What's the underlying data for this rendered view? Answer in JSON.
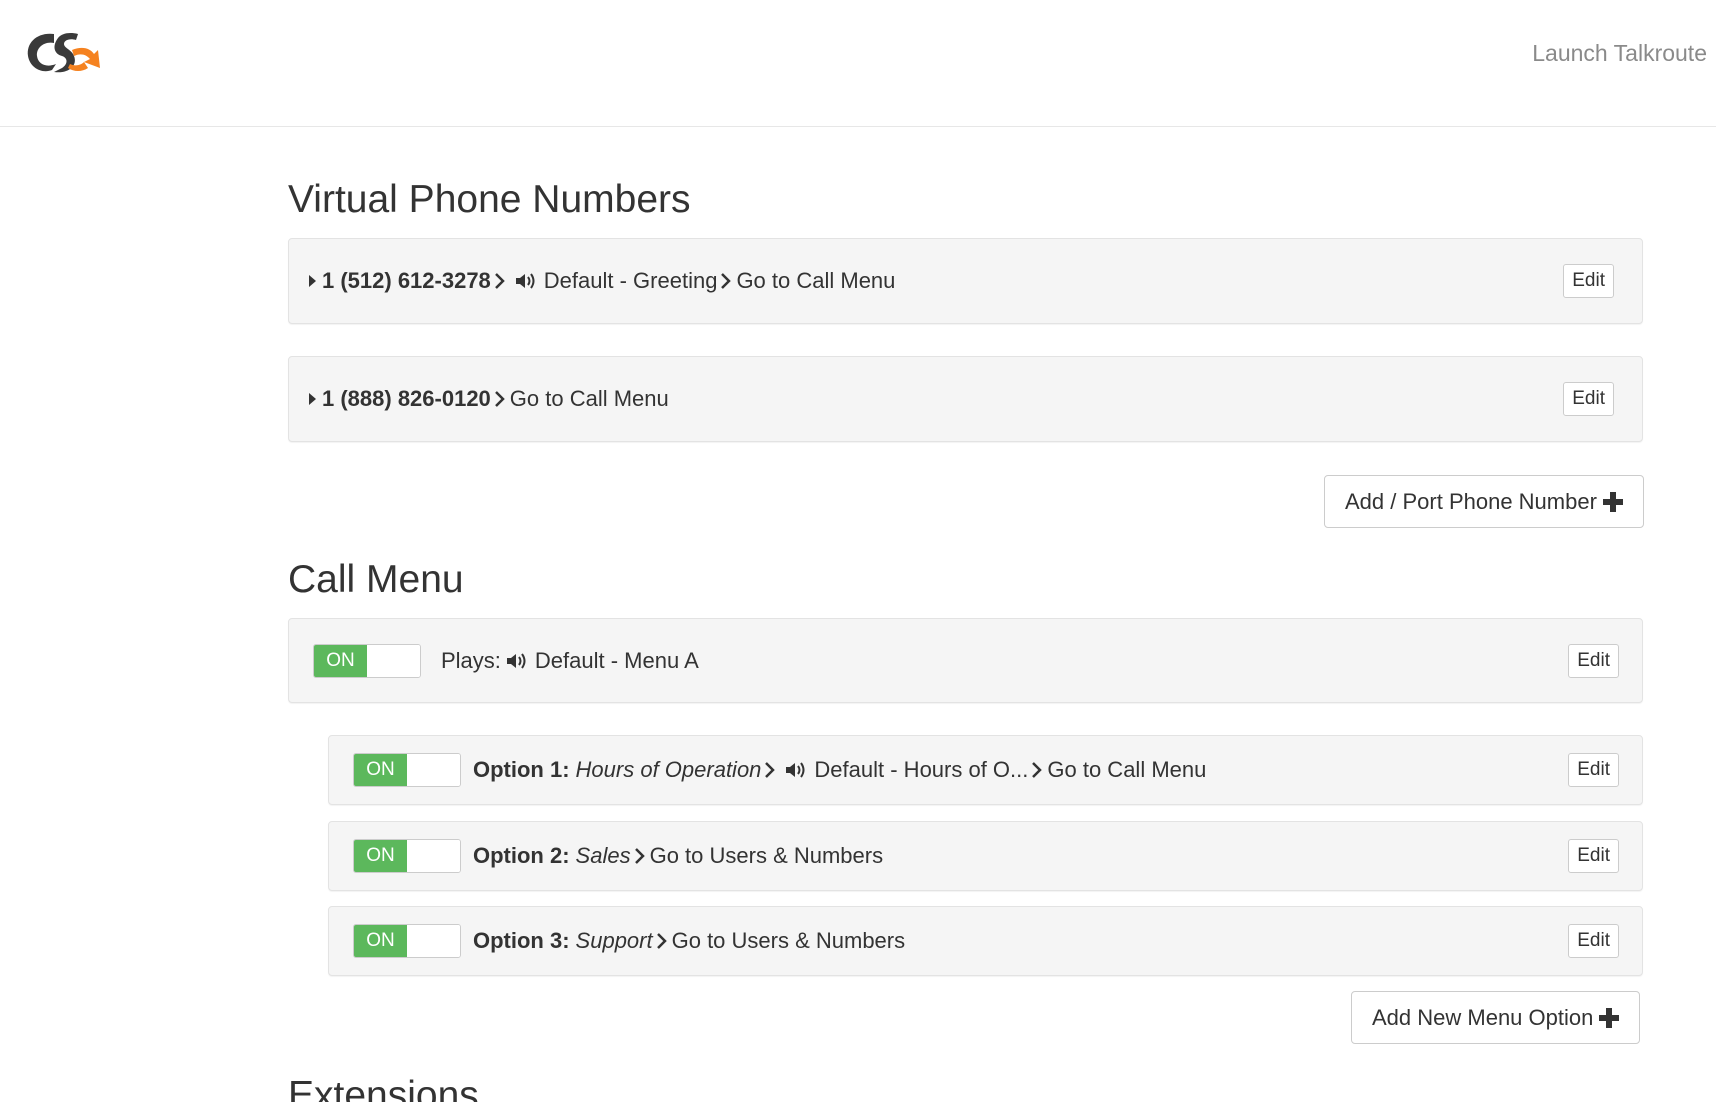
{
  "header": {
    "launch_label": "Launch Talkroute",
    "logo_colors": {
      "dark": "#3a3a3a",
      "accent": "#f58220"
    }
  },
  "phone_numbers": {
    "title": "Virtual Phone Numbers",
    "items": [
      {
        "number": "1 (512) 612-3278",
        "greeting": "Default - Greeting",
        "destination": "Go to Call Menu",
        "edit_label": "Edit"
      },
      {
        "number": "1 (888) 826-0120",
        "destination": "Go to Call Menu",
        "edit_label": "Edit"
      }
    ],
    "add_label": "Add / Port Phone Number"
  },
  "call_menu": {
    "title": "Call Menu",
    "main": {
      "toggle_label": "ON",
      "plays_label": "Plays:",
      "audio": "Default - Menu A",
      "edit_label": "Edit"
    },
    "options": [
      {
        "toggle_label": "ON",
        "label": "Option 1:",
        "name": "Hours of Operation",
        "audio": "Default - Hours of O...",
        "destination": "Go to Call Menu",
        "edit_label": "Edit"
      },
      {
        "toggle_label": "ON",
        "label": "Option 2:",
        "name": "Sales",
        "destination": "Go to Users & Numbers",
        "edit_label": "Edit"
      },
      {
        "toggle_label": "ON",
        "label": "Option 3:",
        "name": "Support",
        "destination": "Go to Users & Numbers",
        "edit_label": "Edit"
      }
    ],
    "add_label": "Add New Menu Option"
  },
  "extensions": {
    "title": "Extensions"
  },
  "colors": {
    "toggle_on": "#5cb85c",
    "panel_bg": "#f5f5f5"
  }
}
